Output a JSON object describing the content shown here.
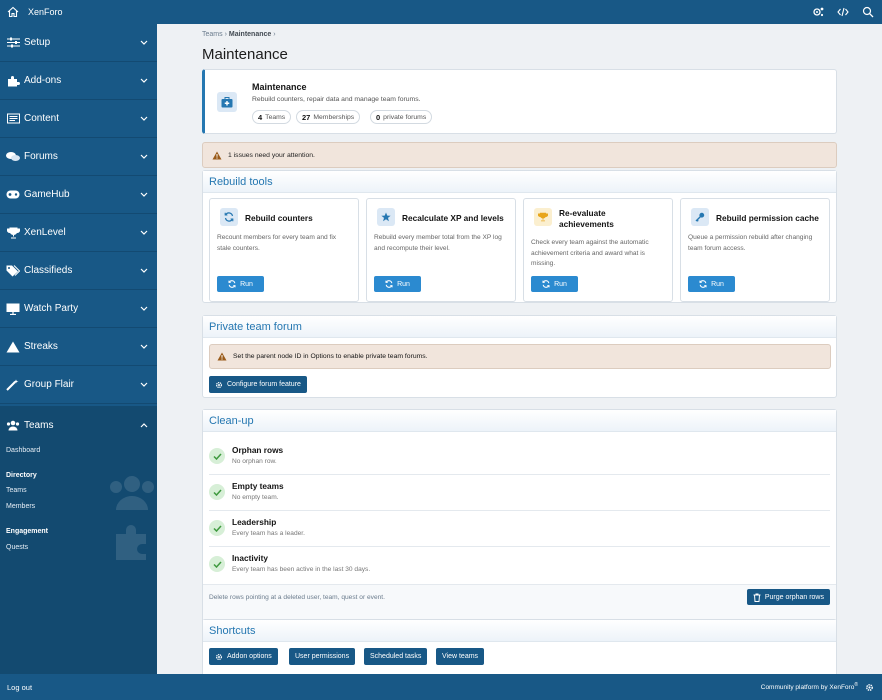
{
  "topbar": {
    "brand": "XenForo"
  },
  "sidebar": {
    "items": [
      {
        "label": "Setup",
        "icon": "sliders-icon"
      },
      {
        "label": "Add-ons",
        "icon": "puzzle-icon"
      },
      {
        "label": "Content",
        "icon": "content-icon"
      },
      {
        "label": "Forums",
        "icon": "comments-icon"
      },
      {
        "label": "GameHub",
        "icon": "gamepad-icon"
      },
      {
        "label": "XenLevel",
        "icon": "trophy-icon"
      },
      {
        "label": "Classifieds",
        "icon": "tags-icon"
      },
      {
        "label": "Watch Party",
        "icon": "monitor-icon"
      },
      {
        "label": "Streaks",
        "icon": "mountain-icon"
      },
      {
        "label": "Group Flair",
        "icon": "magic-icon"
      },
      {
        "label": "Teams",
        "icon": "users-icon"
      }
    ],
    "teams_sub": {
      "dashboard": "Dashboard",
      "directory_heading": "Directory",
      "teams": "Teams",
      "members": "Members",
      "engagement_heading": "Engagement",
      "quests": "Quests"
    }
  },
  "breadcrumb": {
    "first": "Teams",
    "sep": "›",
    "current": "Maintenance"
  },
  "page_title": "Maintenance",
  "hero": {
    "title": "Maintenance",
    "description": "Rebuild counters, repair data and manage team forums.",
    "stats": [
      {
        "value": "4",
        "label": "Teams"
      },
      {
        "value": "27",
        "label": "Memberships"
      },
      {
        "value": "0",
        "label": "private forums"
      }
    ]
  },
  "alert": {
    "text": "1 issues need your attention."
  },
  "rebuild": {
    "heading": "Rebuild tools",
    "run_label": "Run",
    "cards": [
      {
        "title": "Rebuild counters",
        "description": "Recount members for every team and fix stale counters.",
        "icon": "refresh-icon",
        "icon_bg": "#dbe8f5",
        "icon_color": "#2577b1"
      },
      {
        "title": "Recalculate XP and levels",
        "description": "Rebuild every member total from the XP log and recompute their level.",
        "icon": "star-icon",
        "icon_bg": "#dbe8f5",
        "icon_color": "#2577b1"
      },
      {
        "title": "Re-evaluate achievements",
        "description": "Check every team against the automatic achievement criteria and award what is missing.",
        "icon": "trophy-icon",
        "icon_bg": "#fbefcf",
        "icon_color": "#e8a61c"
      },
      {
        "title": "Rebuild permission cache",
        "description": "Queue a permission rebuild after changing team forum access.",
        "icon": "key-icon",
        "icon_bg": "#dbe8f5",
        "icon_color": "#2577b1"
      }
    ]
  },
  "private_forum": {
    "heading": "Private team forum",
    "warning": "Set the parent node ID in Options to enable private team forums.",
    "button": "Configure forum feature"
  },
  "cleanup": {
    "heading": "Clean-up",
    "items": [
      {
        "title": "Orphan rows",
        "description": "No orphan row."
      },
      {
        "title": "Empty teams",
        "description": "No empty team."
      },
      {
        "title": "Leadership",
        "description": "Every team has a leader."
      },
      {
        "title": "Inactivity",
        "description": "Every team has been active in the last 30 days."
      }
    ],
    "footer_text": "Delete rows pointing at a deleted user, team, quest or event.",
    "purge_button": "Purge orphan rows"
  },
  "shortcuts": {
    "heading": "Shortcuts",
    "buttons": [
      "Addon options",
      "User permissions",
      "Scheduled tasks",
      "View teams"
    ]
  },
  "footer": {
    "logout": "Log out",
    "credit": "Community platform by XenForo",
    "credit_mark": "®"
  },
  "colors": {
    "brand": "#185886",
    "accent": "#2577b1",
    "button": "#2b8ad0",
    "success": "#4caf50",
    "warning_bg": "#f1e5dc"
  }
}
